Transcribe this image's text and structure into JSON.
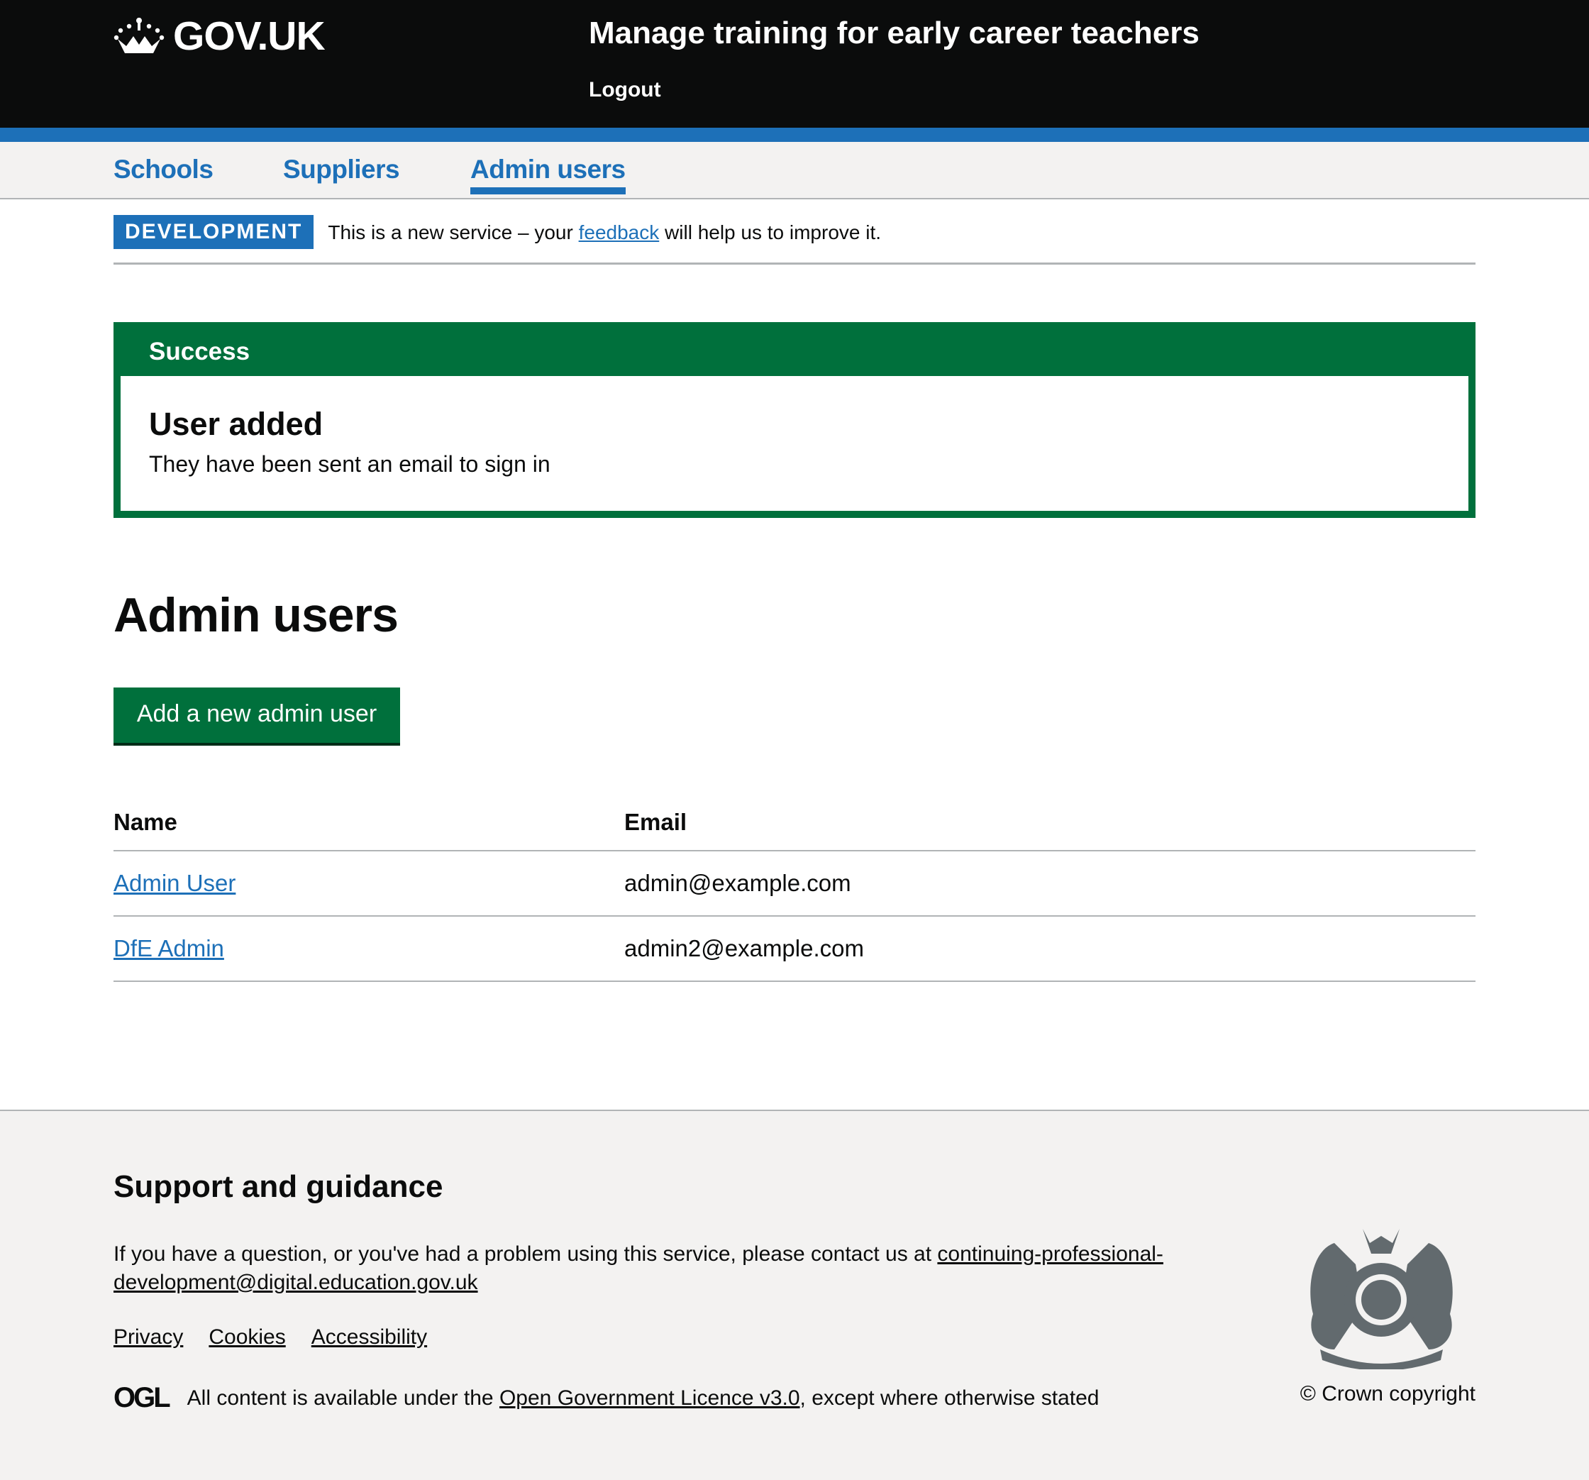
{
  "header": {
    "logo": "GOV.UK",
    "service_name": "Manage training for early career teachers",
    "logout": "Logout"
  },
  "nav": {
    "items": [
      {
        "label": "Schools"
      },
      {
        "label": "Suppliers"
      },
      {
        "label": "Admin users",
        "active": true
      }
    ]
  },
  "phase": {
    "tag": "DEVELOPMENT",
    "text_before": "This is a new service – your ",
    "link": "feedback",
    "text_after": " will help us to improve it."
  },
  "notification": {
    "title": "Success",
    "heading": "User added",
    "body": "They have been sent an email to sign in"
  },
  "main": {
    "title": "Admin users",
    "add_button": "Add a new admin user",
    "table": {
      "headers": [
        "Name",
        "Email"
      ],
      "rows": [
        {
          "name": "Admin User",
          "email": "admin@example.com"
        },
        {
          "name": "DfE Admin",
          "email": "admin2@example.com"
        }
      ]
    }
  },
  "footer": {
    "heading": "Support and guidance",
    "text": "If you have a question, or you've had a problem using this service, please contact us at ",
    "email": "continuing-professional-development@digital.education.gov.uk",
    "links": [
      "Privacy",
      "Cookies",
      "Accessibility"
    ],
    "ogl": "OGL",
    "licence_before": "All content is available under the ",
    "licence_link": "Open Government Licence v3.0",
    "licence_after": ", except where otherwise stated",
    "copyright": "© Crown copyright"
  },
  "colors": {
    "header": "#0b0c0c",
    "brand_blue": "#1d70b8",
    "success_green": "#00703c",
    "footer_bg": "#f3f2f1"
  }
}
